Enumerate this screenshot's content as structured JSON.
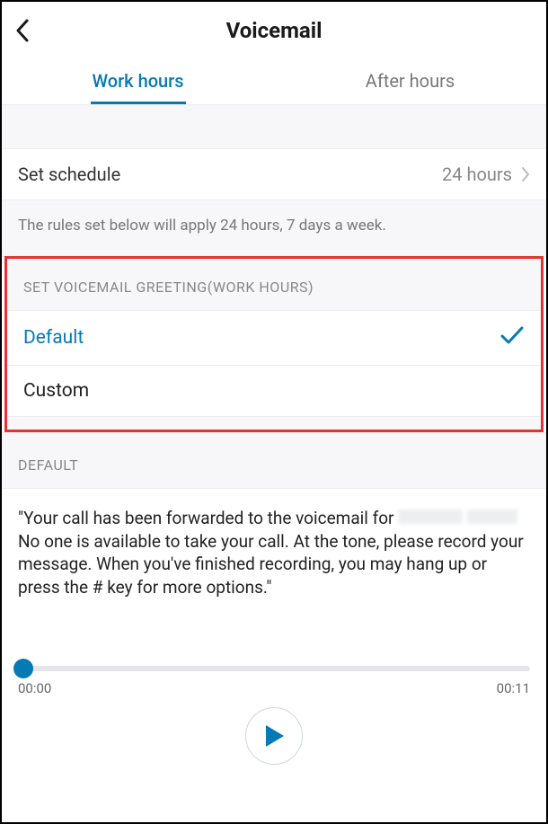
{
  "header": {
    "title": "Voicemail"
  },
  "tabs": {
    "work_hours": "Work hours",
    "after_hours": "After hours"
  },
  "schedule": {
    "label": "Set schedule",
    "value": "24 hours"
  },
  "help_text": "The rules set below will apply 24 hours, 7 days a week.",
  "greeting_section": {
    "header": "SET VOICEMAIL GREETING(WORK HOURS)",
    "options": {
      "default": "Default",
      "custom": "Custom"
    }
  },
  "default_section": {
    "header": "DEFAULT",
    "text_prefix": "\"Your call has been forwarded to the voicemail for ",
    "text_suffix": " No one is available to take your call. At the tone, please record your message. When you've finished recording, you may hang up or press the # key for more options.\""
  },
  "player": {
    "current": "00:00",
    "duration": "00:11"
  }
}
